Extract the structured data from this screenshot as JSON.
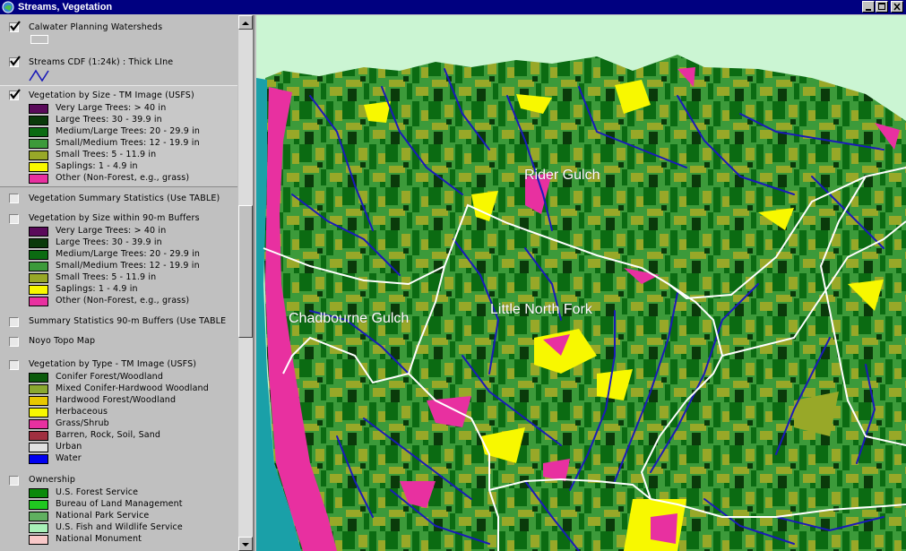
{
  "window": {
    "title": "Streams, Vegetation"
  },
  "toc": {
    "layers": [
      {
        "name": "Calwater Planning Watersheds",
        "checked": true
      },
      {
        "name": "Streams CDF (1:24k) : Thick LIne",
        "checked": true
      },
      {
        "name": "Vegetation by Size - TM Image (USFS)",
        "checked": true,
        "legend": [
          {
            "label": "Very Large Trees: > 40  in",
            "color": "#5a0a5a"
          },
          {
            "label": "Large Trees: 30 - 39.9 in",
            "color": "#0a3a0a"
          },
          {
            "label": "Medium/Large Trees: 20 - 29.9 in",
            "color": "#0b6b12"
          },
          {
            "label": "Small/Medium Trees: 12 - 19.9 in",
            "color": "#3c9a3a"
          },
          {
            "label": "Small Trees: 5 - 11.9 in",
            "color": "#98a828"
          },
          {
            "label": "Saplings: 1 - 4.9 in",
            "color": "#f8f800"
          },
          {
            "label": "Other (Non-Forest, e.g., grass)",
            "color": "#e830a0"
          }
        ]
      },
      {
        "name": "Vegetation Summary Statistics (Use TABLE)",
        "checked": false
      },
      {
        "name": "Vegetation by Size within 90-m Buffers",
        "checked": false,
        "legend": [
          {
            "label": "Very Large Trees: > 40  in",
            "color": "#5a0a5a"
          },
          {
            "label": "Large Trees: 30 - 39.9 in",
            "color": "#0a3a0a"
          },
          {
            "label": "Medium/Large Trees: 20 - 29.9 in",
            "color": "#0b6b12"
          },
          {
            "label": "Small/Medium Trees: 12 - 19.9 in",
            "color": "#3c9a3a"
          },
          {
            "label": "Small Trees: 5 - 11.9 in",
            "color": "#98a828"
          },
          {
            "label": "Saplings: 1 - 4.9 in",
            "color": "#f8f800"
          },
          {
            "label": "Other (Non-Forest, e.g., grass)",
            "color": "#e830a0"
          }
        ]
      },
      {
        "name": "Summary Statistics 90-m Buffers (Use TABLE",
        "checked": false
      },
      {
        "name": "Noyo Topo Map",
        "checked": false
      },
      {
        "name": "Vegetation by Type - TM Image (USFS)",
        "checked": false,
        "legend": [
          {
            "label": "Conifer Forest/Woodland",
            "color": "#0a5a0a"
          },
          {
            "label": "Mixed Conifer-Hardwood Woodland",
            "color": "#8aa830"
          },
          {
            "label": "Hardwood Forest/Woodland",
            "color": "#e8c800"
          },
          {
            "label": "Herbaceous",
            "color": "#f8f800"
          },
          {
            "label": "Grass/Shrub",
            "color": "#e830a0"
          },
          {
            "label": "Barren, Rock, Soil, Sand",
            "color": "#a03040"
          },
          {
            "label": "Urban",
            "color": "#e0e0e0"
          },
          {
            "label": "Water",
            "color": "#0000f0"
          }
        ]
      },
      {
        "name": "Ownership",
        "checked": false,
        "legend": [
          {
            "label": "U.S. Forest Service",
            "color": "#0a8a0a"
          },
          {
            "label": "Bureau of Land Management",
            "color": "#20c820"
          },
          {
            "label": "National Park Service",
            "color": "#60b060"
          },
          {
            "label": "U.S. Fish and Wildlife Service",
            "color": "#a8f0b8"
          },
          {
            "label": "National Monument",
            "color": "#f8c8c8"
          }
        ]
      }
    ]
  },
  "map": {
    "labels": [
      {
        "text": "Rider Gulch"
      },
      {
        "text": "Chadbourne Gulch"
      },
      {
        "text": "Little North Fork"
      }
    ]
  },
  "colors": {
    "titlebar": "#000080",
    "ocean": "#1aa0a8",
    "land_bg": "#cbf5d3",
    "streams": "#1a1ab8",
    "watershed_boundary": "#ffffff"
  }
}
